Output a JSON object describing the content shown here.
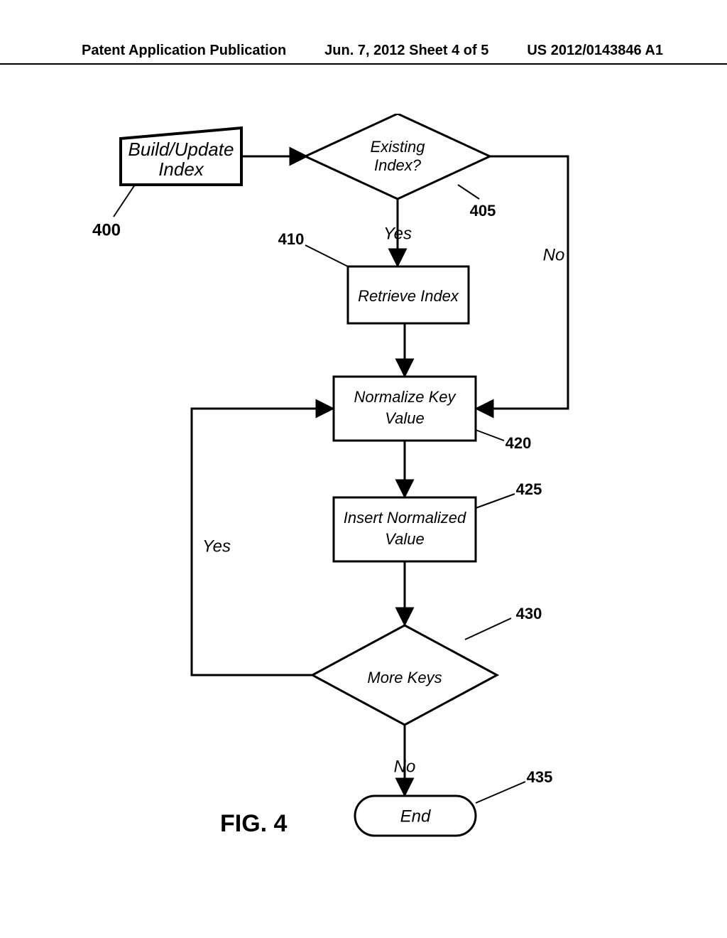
{
  "header": {
    "left": "Patent Application Publication",
    "center": "Jun. 7, 2012   Sheet 4 of 5",
    "right": "US 2012/0143846 A1"
  },
  "figure": {
    "title": "FIG. 4"
  },
  "nodes": {
    "start": {
      "line1": "Build/Update",
      "line2": "Index",
      "ref": "400"
    },
    "decision_index": {
      "line1": "Existing",
      "line2": "Index?",
      "ref": "405"
    },
    "retrieve": {
      "text": "Retrieve Index",
      "ref": "410"
    },
    "normalize": {
      "line1": "Normalize Key",
      "line2": "Value",
      "ref": "420"
    },
    "insert": {
      "line1": "Insert Normalized",
      "line2": "Value",
      "ref": "425"
    },
    "more_keys": {
      "text": "More Keys",
      "ref": "430"
    },
    "end": {
      "text": "End",
      "ref": "435"
    }
  },
  "edges": {
    "yes1": "Yes",
    "no1": "No",
    "yes2": "Yes",
    "no2": "No"
  }
}
